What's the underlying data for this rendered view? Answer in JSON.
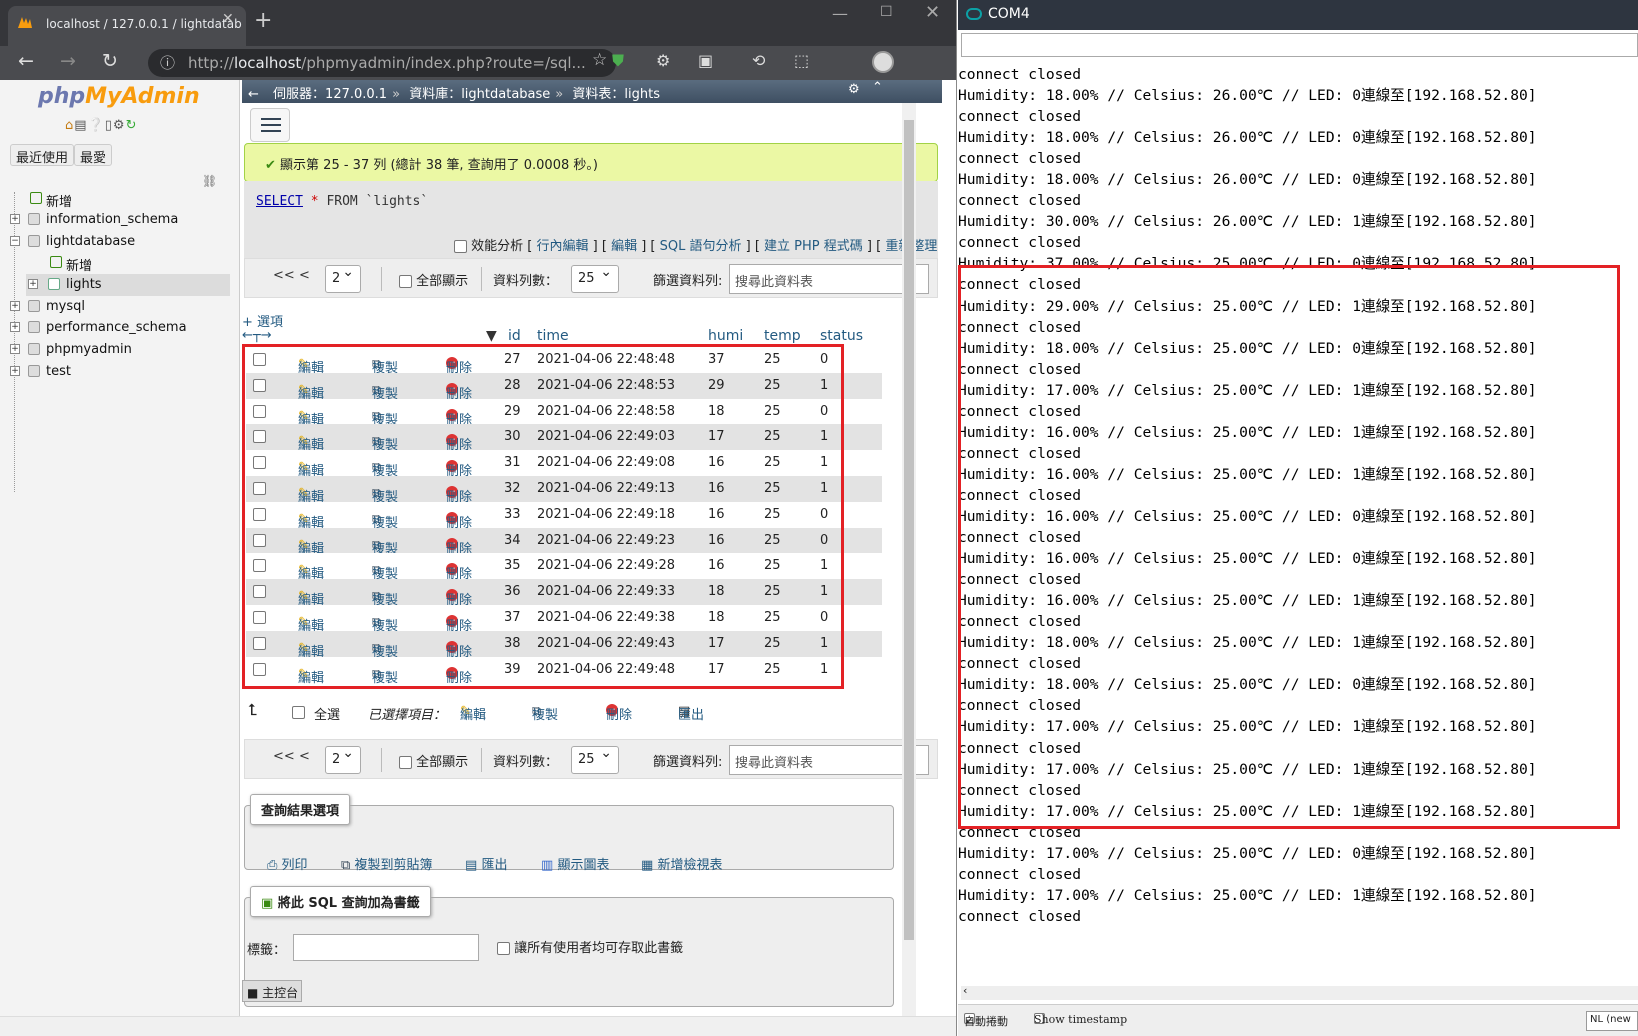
{
  "browser": {
    "tab_title": "localhost / 127.0.0.1 / lightdatab",
    "url_host": "localhost",
    "url_prefix": "http://",
    "url_rest": "/phpmyadmin/index.php?route=/sql...",
    "new_tab": "+",
    "tab_close": "✕"
  },
  "sidebar": {
    "logo_php": "php",
    "logo_myadmin": "MyAdmin",
    "recent_label": "最近使用",
    "favorite_label": "最愛",
    "tree": [
      {
        "label": "新增",
        "level": 1
      },
      {
        "label": "information_schema",
        "level": 0
      },
      {
        "label": "lightdatabase",
        "level": 0
      },
      {
        "label": "新增",
        "level": 2
      },
      {
        "label": "lights",
        "level": 2
      },
      {
        "label": "mysql",
        "level": 0
      },
      {
        "label": "performance_schema",
        "level": 0
      },
      {
        "label": "phpmyadmin",
        "level": 0
      },
      {
        "label": "test",
        "level": 0
      }
    ]
  },
  "topbar": {
    "server": "伺服器：127.0.0.1",
    "database": "資料庫：lightdatabase",
    "table": "資料表：lights"
  },
  "message": {
    "success": "顯示第 25 - 37 列 (總計 38 筆, 查詢用了 0.0008 秒。)"
  },
  "sql": {
    "select": "SELECT",
    "star": "*",
    "from_clause": "FROM `lights`",
    "profiling": "效能分析",
    "links": [
      "行內編輯",
      "編輯",
      "SQL 語句分析",
      "建立 PHP 程式碼",
      "重新整理"
    ]
  },
  "nav": {
    "first": "<<",
    "prev": "<",
    "page": "2",
    "show_all": "全部顯示",
    "rows_label": "資料列數：",
    "rows_value": "25",
    "filter_label": "篩選資料列:",
    "filter_placeholder": "搜尋此資料表"
  },
  "table": {
    "options_link": "+ 選項",
    "columns": [
      "id",
      "time",
      "humi",
      "temp",
      "status"
    ],
    "edit_label": "編輯",
    "copy_label": "複製",
    "delete_label": "刪除",
    "rows": [
      {
        "id": "27",
        "time": "2021-04-06 22:48:48",
        "humi": "37",
        "temp": "25",
        "status": "0"
      },
      {
        "id": "28",
        "time": "2021-04-06 22:48:53",
        "humi": "29",
        "temp": "25",
        "status": "1"
      },
      {
        "id": "29",
        "time": "2021-04-06 22:48:58",
        "humi": "18",
        "temp": "25",
        "status": "0"
      },
      {
        "id": "30",
        "time": "2021-04-06 22:49:03",
        "humi": "17",
        "temp": "25",
        "status": "1"
      },
      {
        "id": "31",
        "time": "2021-04-06 22:49:08",
        "humi": "16",
        "temp": "25",
        "status": "1"
      },
      {
        "id": "32",
        "time": "2021-04-06 22:49:13",
        "humi": "16",
        "temp": "25",
        "status": "1"
      },
      {
        "id": "33",
        "time": "2021-04-06 22:49:18",
        "humi": "16",
        "temp": "25",
        "status": "0"
      },
      {
        "id": "34",
        "time": "2021-04-06 22:49:23",
        "humi": "16",
        "temp": "25",
        "status": "0"
      },
      {
        "id": "35",
        "time": "2021-04-06 22:49:28",
        "humi": "16",
        "temp": "25",
        "status": "1"
      },
      {
        "id": "36",
        "time": "2021-04-06 22:49:33",
        "humi": "18",
        "temp": "25",
        "status": "1"
      },
      {
        "id": "37",
        "time": "2021-04-06 22:49:38",
        "humi": "18",
        "temp": "25",
        "status": "0"
      },
      {
        "id": "38",
        "time": "2021-04-06 22:49:43",
        "humi": "17",
        "temp": "25",
        "status": "1"
      },
      {
        "id": "39",
        "time": "2021-04-06 22:49:48",
        "humi": "17",
        "temp": "25",
        "status": "1"
      }
    ]
  },
  "bulk": {
    "select_all": "全選",
    "with_selected": "已選擇項目：",
    "edit": "編輯",
    "copy": "複製",
    "delete": "刪除",
    "export": "匯出"
  },
  "query_results": {
    "legend": "查詢結果選項",
    "items": [
      "列印",
      "複製到剪貼簿",
      "匯出",
      "顯示圖表",
      "新增檢視表"
    ]
  },
  "bookmark": {
    "legend": "將此 SQL 查詢加為書籤",
    "label": "標籤：",
    "share": "讓所有使用者均可存取此書籤"
  },
  "console_tab": "主控台",
  "serial": {
    "title": "COM4",
    "lines": [
      "connect closed",
      "Humidity: 18.00% // Celsius: 26.00℃ // LED: 0連線至[192.168.52.80]",
      "connect closed",
      "Humidity: 18.00% // Celsius: 26.00℃ // LED: 0連線至[192.168.52.80]",
      "connect closed",
      "Humidity: 18.00% // Celsius: 26.00℃ // LED: 0連線至[192.168.52.80]",
      "connect closed",
      "Humidity: 30.00% // Celsius: 26.00℃ // LED: 1連線至[192.168.52.80]",
      "connect closed",
      "Humidity: 37.00% // Celsius: 25.00℃ // LED: 0連線至[192.168.52.80]",
      "connect closed",
      "Humidity: 29.00% // Celsius: 25.00℃ // LED: 1連線至[192.168.52.80]",
      "connect closed",
      "Humidity: 18.00% // Celsius: 25.00℃ // LED: 0連線至[192.168.52.80]",
      "connect closed",
      "Humidity: 17.00% // Celsius: 25.00℃ // LED: 1連線至[192.168.52.80]",
      "connect closed",
      "Humidity: 16.00% // Celsius: 25.00℃ // LED: 1連線至[192.168.52.80]",
      "connect closed",
      "Humidity: 16.00% // Celsius: 25.00℃ // LED: 1連線至[192.168.52.80]",
      "connect closed",
      "Humidity: 16.00% // Celsius: 25.00℃ // LED: 0連線至[192.168.52.80]",
      "connect closed",
      "Humidity: 16.00% // Celsius: 25.00℃ // LED: 0連線至[192.168.52.80]",
      "connect closed",
      "Humidity: 16.00% // Celsius: 25.00℃ // LED: 1連線至[192.168.52.80]",
      "connect closed",
      "Humidity: 18.00% // Celsius: 25.00℃ // LED: 1連線至[192.168.52.80]",
      "connect closed",
      "Humidity: 18.00% // Celsius: 25.00℃ // LED: 0連線至[192.168.52.80]",
      "connect closed",
      "Humidity: 17.00% // Celsius: 25.00℃ // LED: 1連線至[192.168.52.80]",
      "connect closed",
      "Humidity: 17.00% // Celsius: 25.00℃ // LED: 1連線至[192.168.52.80]",
      "connect closed",
      "Humidity: 17.00% // Celsius: 25.00℃ // LED: 1連線至[192.168.52.80]",
      "connect closed",
      "Humidity: 17.00% // Celsius: 25.00℃ // LED: 0連線至[192.168.52.80]",
      "connect closed",
      "Humidity: 17.00% // Celsius: 25.00℃ // LED: 1連線至[192.168.52.80]",
      "connect closed"
    ],
    "autoscroll": "自動捲動",
    "timestamp": "Show timestamp",
    "line_ending": "NL (new"
  },
  "colors": {
    "highlight_box": "#e32125",
    "link": "#235a81",
    "success_bg": "#ebf8a4"
  }
}
